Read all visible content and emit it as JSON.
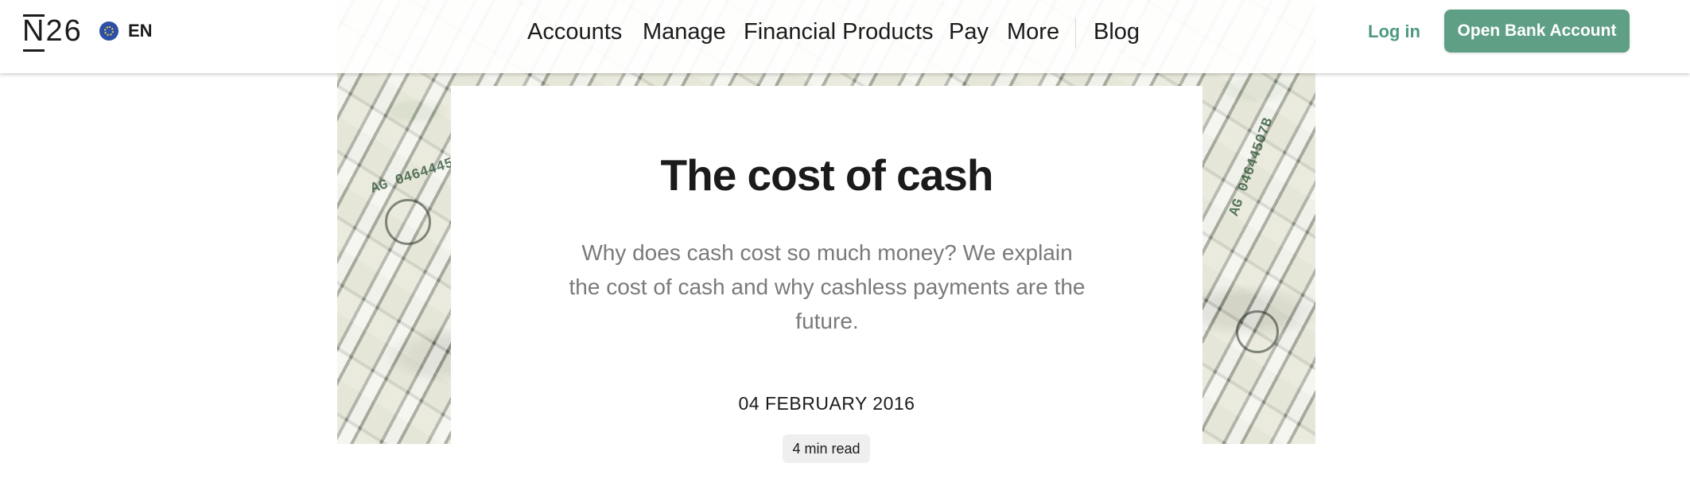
{
  "header": {
    "logo_text": "N26",
    "language": {
      "label": "EN",
      "icon": "eu-flag-icon"
    },
    "nav": [
      "Accounts",
      "Manage",
      "Financial Products",
      "Pay",
      "More",
      "Blog"
    ],
    "login_label": "Log in",
    "cta_label": "Open Bank Account"
  },
  "article": {
    "title": "The cost of cash",
    "lede": "Why does cash cost so much money? We explain the cost of cash and why cashless payments are the future.",
    "date": "04 FEBRUARY 2016",
    "read_time": "4 min read"
  },
  "colors": {
    "accent": "#5f9f86",
    "login_text": "#4e9a7e",
    "lede_text": "#7a7a7a"
  }
}
